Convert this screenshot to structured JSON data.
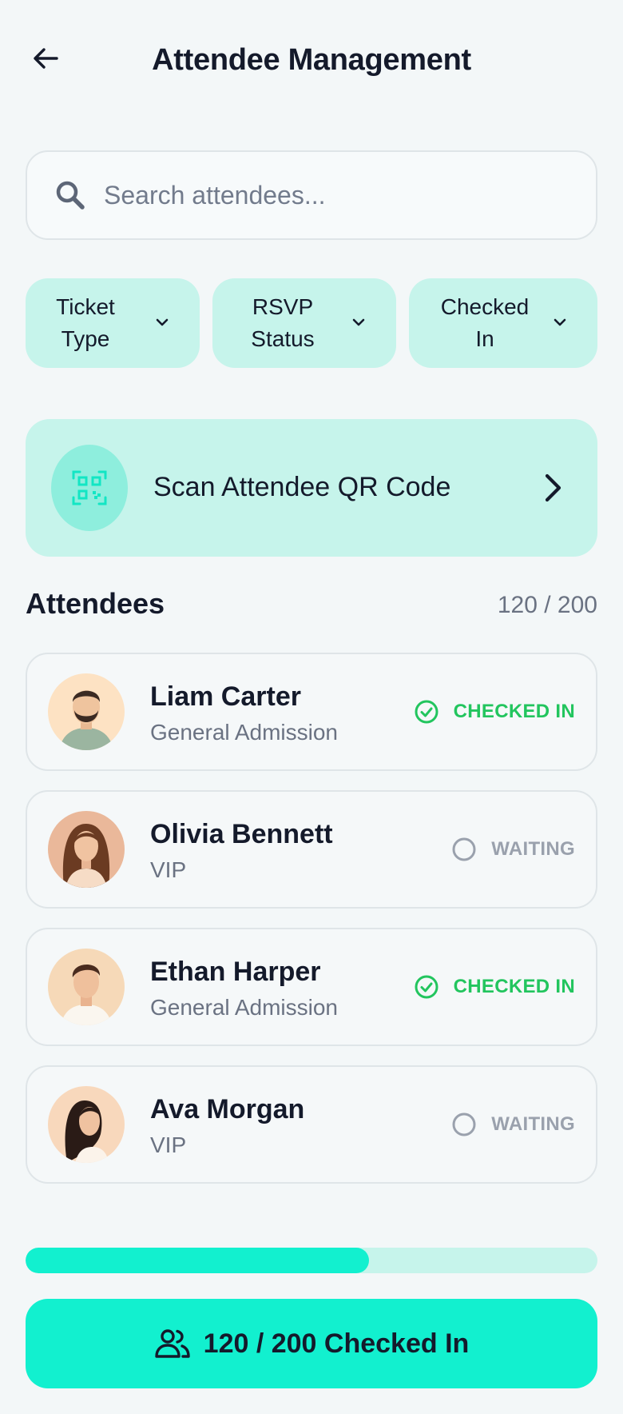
{
  "header": {
    "title": "Attendee Management",
    "back_icon": "arrow-left-icon"
  },
  "search": {
    "placeholder": "Search attendees...",
    "value": "",
    "icon": "search-icon"
  },
  "filters": [
    {
      "label_line1": "Ticket",
      "label_line2": "Type"
    },
    {
      "label_line1": "RSVP",
      "label_line2": "Status"
    },
    {
      "label_line1": "Checked",
      "label_line2": "In"
    }
  ],
  "scan": {
    "label": "Scan Attendee QR Code",
    "icon": "qr-code-icon"
  },
  "attendees_section": {
    "title": "Attendees",
    "count": "120 / 200"
  },
  "attendees": [
    {
      "name": "Liam Carter",
      "ticket": "General Admission",
      "status": "CHECKED IN",
      "state": "in"
    },
    {
      "name": "Olivia Bennett",
      "ticket": "VIP",
      "status": "WAITING",
      "state": "wait"
    },
    {
      "name": "Ethan Harper",
      "ticket": "General Admission",
      "status": "CHECKED IN",
      "state": "in"
    },
    {
      "name": "Ava Morgan",
      "ticket": "VIP",
      "status": "WAITING",
      "state": "wait"
    }
  ],
  "progress": {
    "fraction": 0.6
  },
  "cta": {
    "label": "120 / 200 Checked In",
    "icon": "users-icon"
  },
  "colors": {
    "accent": "#12f0cf",
    "accent_soft": "#c6f4eb",
    "checked_in": "#22c55e",
    "waiting": "#9aa1ad",
    "text": "#141a2b",
    "background": "#f3f7f8"
  }
}
